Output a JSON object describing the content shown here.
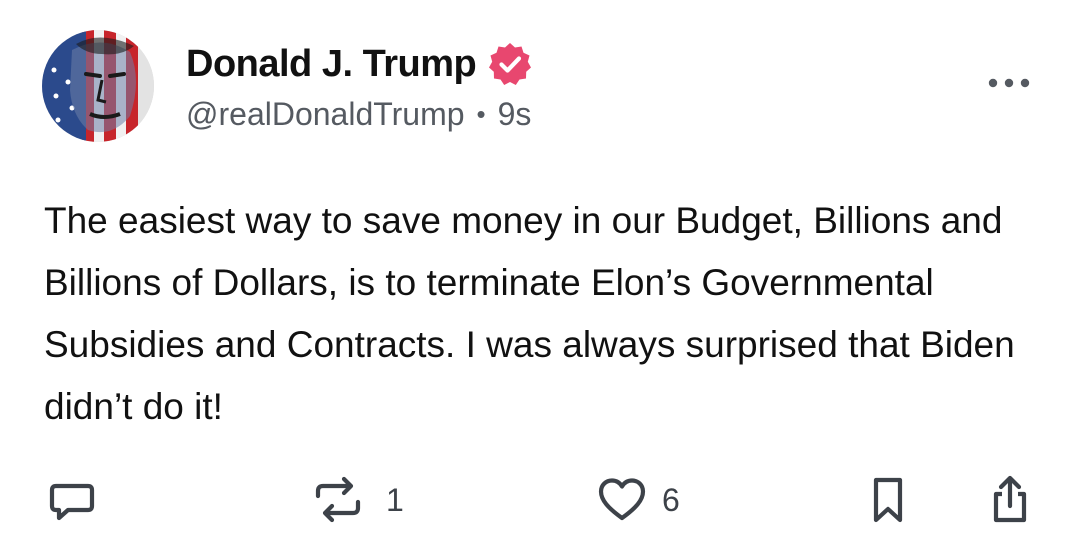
{
  "author": {
    "display_name": "Donald J. Trump",
    "handle": "@realDonaldTrump",
    "separator": "•",
    "time_ago": "9s",
    "verified_color": "#e8476f"
  },
  "post": {
    "text": "The easiest way to save money in our Budget, Billions and Billions of Dollars, is to terminate Elon’s Governmental Subsidies and Contracts. I was always surprised that Biden didn’t do it!"
  },
  "actions": {
    "reply": {
      "icon": "reply-icon"
    },
    "repost": {
      "icon": "repost-icon",
      "count": "1"
    },
    "like": {
      "icon": "heart-icon",
      "count": "6"
    },
    "bookmark": {
      "icon": "bookmark-icon"
    },
    "share": {
      "icon": "share-icon"
    }
  },
  "colors": {
    "text": "#111111",
    "secondary": "#555a61",
    "icons": "#3d4249",
    "background": "#ffffff"
  }
}
